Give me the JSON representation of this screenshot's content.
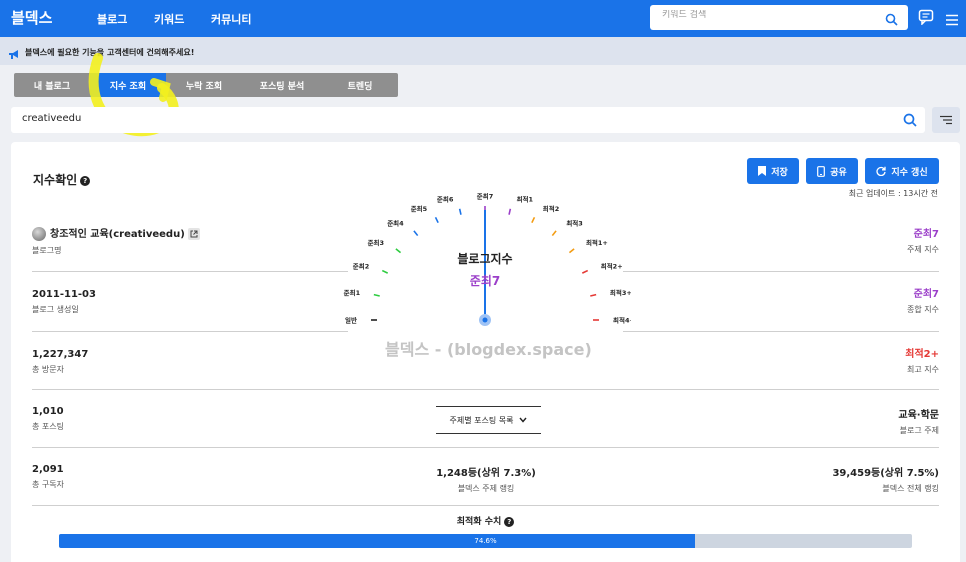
{
  "nav": {
    "logo": "블덱스",
    "links": [
      "블로그",
      "키워드",
      "커뮤니티"
    ],
    "search_placeholder": "키워드 검색"
  },
  "notice": {
    "text": "블덱스에 필요한 기능을 고객센터에 건의해주세요!"
  },
  "tabs": [
    {
      "label": "내 블로그",
      "active": false
    },
    {
      "label": "지수 조회",
      "active": true
    },
    {
      "label": "누락 조회",
      "active": false
    },
    {
      "label": "포스팅 분석",
      "active": false
    },
    {
      "label": "트렌딩",
      "active": false
    }
  ],
  "search": {
    "value": "creativeedu"
  },
  "card": {
    "title": "지수확인",
    "buttons": {
      "save": "저장",
      "share": "공유",
      "refresh": "지수 갱신"
    },
    "updated": "최근 업데이트 : 13시간 전",
    "blog_name": {
      "value": "창조적인 교육(creativeedu)",
      "label": "블로그명"
    },
    "created": {
      "value": "2011-11-03",
      "label": "블로그 생성일"
    },
    "visitors": {
      "value": "1,227,347",
      "label": "총 방문자"
    },
    "posts": {
      "value": "1,010",
      "label": "총 포스팅"
    },
    "subscribers": {
      "value": "2,091",
      "label": "총 구독자"
    },
    "right": {
      "topic_index": {
        "value": "준최7",
        "label": "주제 지수"
      },
      "total_index": {
        "value": "준최7",
        "label": "종합 지수"
      },
      "max_index": {
        "value": "최적2+",
        "label": "최고 지수"
      },
      "blog_topic": {
        "value": "교육·학문",
        "label": "블로그 주제"
      },
      "total_rank": {
        "value": "39,459등(상위 7.5%)",
        "label": "블덱스 전체 랭킹"
      }
    },
    "center": {
      "topic_rank": {
        "value": "1,248등(상위 7.3%)",
        "label": "블덱스 주제 랭킹"
      },
      "dropdown": "주제별 포스팅 목록"
    },
    "gauge": {
      "title": "블로그지수",
      "value": "준최7",
      "labels": [
        "일반",
        "준최1",
        "준최2",
        "준최3",
        "준최4",
        "준최5",
        "준최6",
        "준최7",
        "최적1",
        "최적2",
        "최적3",
        "최적1+",
        "최적2+",
        "최적3+",
        "최적4+"
      ]
    },
    "watermark": "블덱스 - (blogdex.space)",
    "optimization": {
      "title": "최적화 수치",
      "percent": 74.6,
      "text": "74.6%"
    }
  },
  "colors": {
    "primary": "#1a73e8",
    "purple": "#9b3fc9",
    "red": "#e53935",
    "highlight": "#f3ef1e"
  }
}
